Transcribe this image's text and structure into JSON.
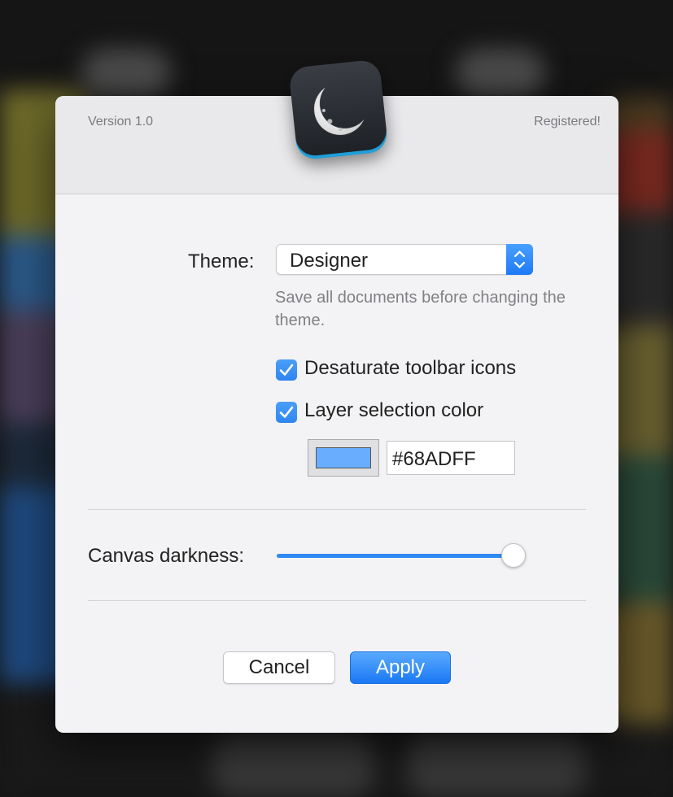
{
  "header": {
    "version": "Version 1.0",
    "status": "Registered!",
    "app_icon": "crescent-moon-icon"
  },
  "theme": {
    "label": "Theme:",
    "selected": "Designer",
    "note": "Save all documents before changing the theme."
  },
  "options": {
    "desaturate": {
      "label": "Desaturate toolbar icons",
      "checked": true
    },
    "layer_selection": {
      "label": "Layer selection color",
      "checked": true
    }
  },
  "selection_color": {
    "hex": "#68ADFF",
    "swatch": "#68ADFF"
  },
  "canvas": {
    "label": "Canvas darkness:",
    "value": 0.97
  },
  "buttons": {
    "cancel": "Cancel",
    "apply": "Apply"
  },
  "colors": {
    "accent": "#1D7AF5"
  }
}
